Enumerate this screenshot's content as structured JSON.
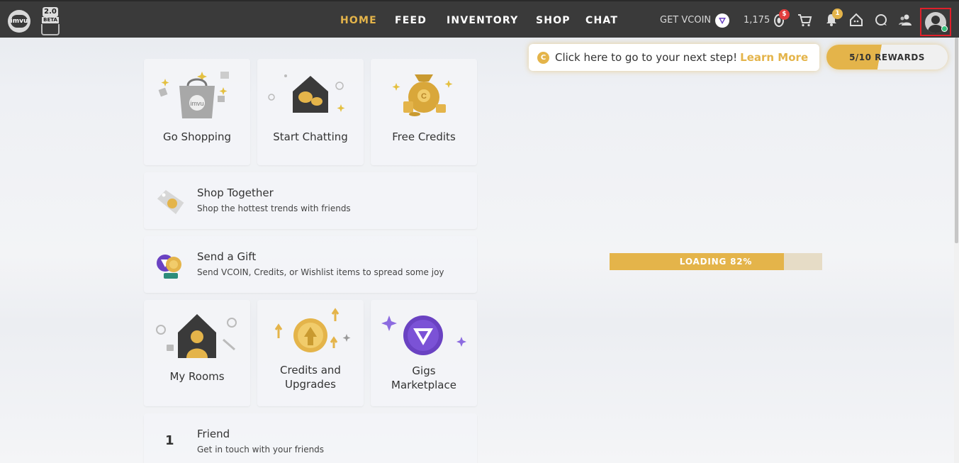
{
  "topbar": {
    "logo_text": "imvu",
    "beta_version": "2.0",
    "beta_label": "BETA",
    "nav": {
      "home": "HOME",
      "feed": "FEED",
      "inventory": "INVENTORY",
      "shop": "SHOP",
      "chat": "CHAT"
    },
    "get_vcoin": "GET VCOIN",
    "credits_count": "1,175",
    "dollar_badge": "$",
    "notification_badge": "1"
  },
  "step_banner": {
    "coin": "C",
    "text": "Click here to go to your next step!",
    "link": "Learn More",
    "rewards": "5/10 REWARDS",
    "rewards_progress": 0.5
  },
  "cards": {
    "go_shopping": "Go Shopping",
    "start_chatting": "Start Chatting",
    "free_credits": "Free Credits",
    "shop_together": {
      "title": "Shop Together",
      "subtitle": "Shop the hottest trends with friends"
    },
    "send_gift": {
      "title": "Send a Gift",
      "subtitle": "Send VCOIN, Credits, or Wishlist items to spread some joy"
    },
    "my_rooms": "My Rooms",
    "credits_upgrades_1": "Credits and",
    "credits_upgrades_2": "Upgrades",
    "gigs_1": "Gigs",
    "gigs_2": "Marketplace",
    "friend": {
      "count": "1",
      "title": "Friend",
      "subtitle": "Get in touch with your friends"
    }
  },
  "loading": {
    "text": "LOADING 82%",
    "percent": 82
  },
  "colors": {
    "accent": "#e4b44a",
    "topbar": "#3a3a3a",
    "vcoin": "#6a42c2",
    "badge_red": "#e23d3d"
  }
}
